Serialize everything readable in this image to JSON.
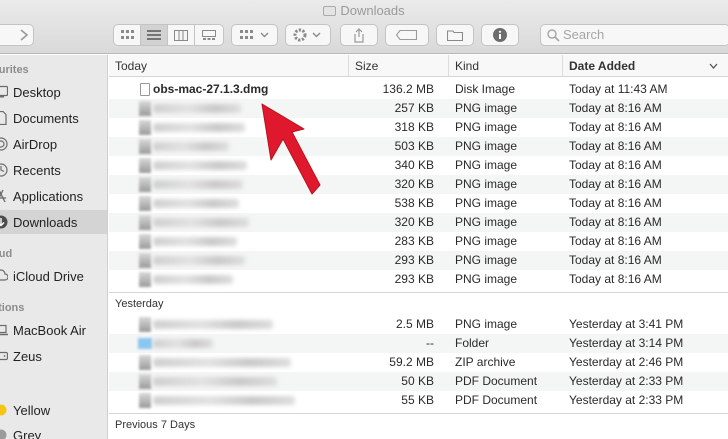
{
  "window": {
    "title": "Downloads"
  },
  "toolbar": {
    "search_placeholder": "Search",
    "icons": [
      "back-icon",
      "forward-icon",
      "icon-view-icon",
      "list-view-icon",
      "column-view-icon",
      "gallery-view-icon",
      "group-icon",
      "action-gear-icon",
      "share-icon",
      "tag-icon",
      "new-folder-icon",
      "info-icon",
      "search-icon"
    ]
  },
  "sidebar": {
    "sections": [
      {
        "label": "ourites"
      },
      {
        "label": "oud"
      },
      {
        "label": "ations"
      },
      {
        "label": "s"
      }
    ],
    "items": [
      {
        "label": "Desktop",
        "icon": "desktop-icon"
      },
      {
        "label": "Documents",
        "icon": "documents-icon"
      },
      {
        "label": "AirDrop",
        "icon": "airdrop-icon"
      },
      {
        "label": "Recents",
        "icon": "recents-icon"
      },
      {
        "label": "Applications",
        "icon": "applications-icon"
      },
      {
        "label": "Downloads",
        "icon": "downloads-icon",
        "selected": true
      },
      {
        "label": "iCloud Drive",
        "icon": "icloud-icon"
      },
      {
        "label": "MacBook Air",
        "icon": "laptop-icon"
      },
      {
        "label": "Zeus",
        "icon": "disk-icon"
      },
      {
        "label": "Yellow",
        "icon": "tag-dot-icon",
        "color": "#f5c518"
      },
      {
        "label": "Grey",
        "icon": "tag-dot-icon",
        "color": "#9b9b9b"
      }
    ]
  },
  "columns": {
    "name": "Today",
    "size": "Size",
    "kind": "Kind",
    "date": "Date Added"
  },
  "groups": [
    {
      "label": "Today",
      "rows": [
        {
          "name": "obs-mac-27.1.3.dmg",
          "size": "136.2 MB",
          "kind": "Disk Image",
          "date": "Today at 11:43 AM"
        },
        {
          "name": "",
          "size": "257 KB",
          "kind": "PNG image",
          "date": "Today at 8:16 AM"
        },
        {
          "name": "",
          "size": "318 KB",
          "kind": "PNG image",
          "date": "Today at 8:16 AM"
        },
        {
          "name": "",
          "size": "503 KB",
          "kind": "PNG image",
          "date": "Today at 8:16 AM"
        },
        {
          "name": "",
          "size": "340 KB",
          "kind": "PNG image",
          "date": "Today at 8:16 AM"
        },
        {
          "name": "",
          "size": "320 KB",
          "kind": "PNG image",
          "date": "Today at 8:16 AM"
        },
        {
          "name": "",
          "size": "538 KB",
          "kind": "PNG image",
          "date": "Today at 8:16 AM"
        },
        {
          "name": "",
          "size": "320 KB",
          "kind": "PNG image",
          "date": "Today at 8:16 AM"
        },
        {
          "name": "",
          "size": "283 KB",
          "kind": "PNG image",
          "date": "Today at 8:16 AM"
        },
        {
          "name": "",
          "size": "293 KB",
          "kind": "PNG image",
          "date": "Today at 8:16 AM"
        },
        {
          "name": "",
          "size": "293 KB",
          "kind": "PNG image",
          "date": "Today at 8:16 AM"
        }
      ]
    },
    {
      "label": "Yesterday",
      "rows": [
        {
          "name": "",
          "size": "2.5 MB",
          "kind": "PNG image",
          "date": "Yesterday at 3:41 PM"
        },
        {
          "name": "",
          "size": "--",
          "kind": "Folder",
          "date": "Yesterday at 3:14 PM",
          "folder": true
        },
        {
          "name": "",
          "size": "59.2 MB",
          "kind": "ZIP archive",
          "date": "Yesterday at 2:46 PM"
        },
        {
          "name": "",
          "size": "50 KB",
          "kind": "PDF Document",
          "date": "Yesterday at 2:33 PM"
        },
        {
          "name": "",
          "size": "55 KB",
          "kind": "PDF Document",
          "date": "Yesterday at 2:33 PM"
        }
      ]
    },
    {
      "label": "Previous 7 Days",
      "rows": []
    }
  ],
  "annotation": {
    "color": "#e0182d"
  }
}
